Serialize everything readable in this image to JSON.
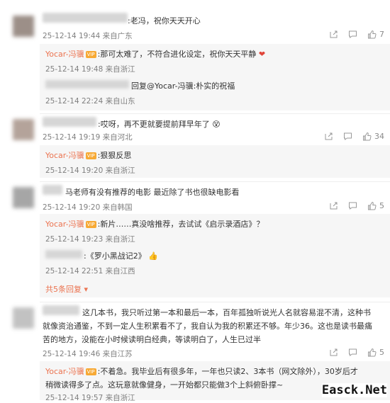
{
  "comments": [
    {
      "text": ":老冯，祝你天天开心",
      "meta": "25-12-14 19:44 来自广东",
      "likes": "7",
      "replies": [
        {
          "name": "Yocar-冯骥",
          "text": ":那可太难了，不符合进化设定，祝你天天平静",
          "meta": "25-12-14 19:48 来自浙江"
        },
        {
          "name": "",
          "text": "回复@Yocar-冯骥:朴实的祝福",
          "meta": "25-12-14 22:24 来自山东"
        }
      ]
    },
    {
      "text": ":哎呀，再不更就要提前拜早年了",
      "meta": "25-12-14 19:19 来自河北",
      "likes": "34",
      "replies": [
        {
          "name": "Yocar-冯骥",
          "text": ":狠狠反思",
          "meta": "25-12-14 19:20 来自浙江"
        }
      ]
    },
    {
      "text": "马老师有没有推荐的电影 最近除了书也很缺电影看",
      "meta": "25-12-14 19:20 来自韩国",
      "likes": "5",
      "replies": [
        {
          "name": "Yocar-冯骥",
          "text": ":新片……真没啥推荐，去试试《启示录酒店》？",
          "meta": "25-12-14 19:23 来自浙江"
        },
        {
          "name": "",
          "text": ":《罗小黑战记2》",
          "meta": "25-12-14 22:51 来自江西"
        }
      ],
      "expand": "共5条回复"
    },
    {
      "text_line1": "这几本书，我只听过第一本和最后一本，百年孤独听说光人名就容易混不清，这种书",
      "text_line2": "就像资治通鉴，不到一定人生积累看不了，我自认为我的积累还不够。年少36。这也是读书最痛",
      "text_line3": "苦的地方，没能在小时候读明白经典，等读明白了，人生已过半",
      "meta": "25-12-14 19:46 来自江苏",
      "likes": "5",
      "replies": [
        {
          "name": "Yocar-冯骥",
          "text_line1": ":不着急。我毕业后有很多年，一年也只读2、3本书（网文除外），30岁后才",
          "text_line2": "稍微读得多了点。这玩意就像健身，一开始都只能做3个上斜俯卧撑~",
          "meta": "25-12-14 19:57 来自浙江"
        }
      ]
    }
  ],
  "vip_label": "VIP",
  "watermark": "Easck.Net",
  "icons": [
    "share-icon",
    "comment-icon",
    "like-icon"
  ]
}
